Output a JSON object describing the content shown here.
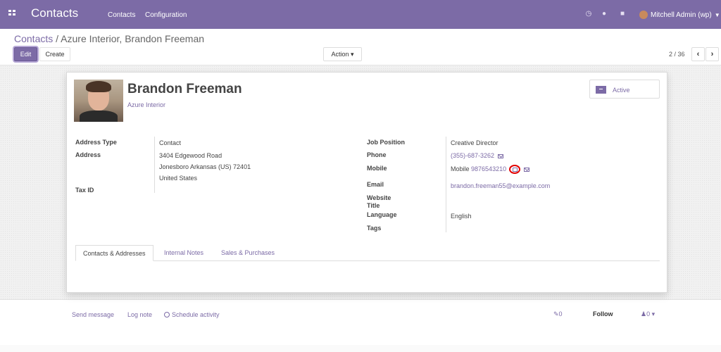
{
  "app": {
    "name": "Contacts",
    "menu": [
      "Contacts",
      "Configuration"
    ],
    "user": "Mitchell Admin (wp)"
  },
  "breadcrumb": {
    "parent": "Contacts",
    "separator": " / ",
    "current": "Azure Interior, Brandon Freeman"
  },
  "toolbar": {
    "edit": "Edit",
    "create": "Create",
    "action": "Action ▾",
    "pager": "2 / 36",
    "prev": "‹",
    "next": "›"
  },
  "record": {
    "name": "Brandon Freeman",
    "company": "Azure Interior",
    "status_button": "Active",
    "left_fields": [
      {
        "label": "Address Type",
        "value": "Contact"
      },
      {
        "label": "Address",
        "lines": [
          "3404 Edgewood Road",
          "Jonesboro  Arkansas (US)  72401",
          "United States"
        ]
      },
      {
        "label": "Tax ID",
        "value": ""
      }
    ],
    "right_fields": {
      "job_position": {
        "label": "Job Position",
        "value": "Creative Director"
      },
      "phone": {
        "label": "Phone",
        "value": "(355)-687-3262"
      },
      "mobile": {
        "label": "Mobile",
        "prefix": "Mobile",
        "value": "9876543210"
      },
      "email": {
        "label": "Email",
        "value": "brandon.freeman55@example.com"
      },
      "website": {
        "label": "Website",
        "value": ""
      },
      "title": {
        "label": "Title",
        "value": ""
      },
      "language": {
        "label": "Language",
        "value": "English"
      },
      "tags": {
        "label": "Tags",
        "value": ""
      }
    }
  },
  "tabs": [
    "Contacts & Addresses",
    "Internal Notes",
    "Sales & Purchases"
  ],
  "chatter": {
    "send_message": "Send message",
    "log_note": "Log note",
    "schedule_activity": "Schedule activity",
    "attachments": "0",
    "follow": "Follow",
    "followers": "0"
  },
  "colors": {
    "brand": "#7c6ba6",
    "highlight": "#e20000"
  }
}
